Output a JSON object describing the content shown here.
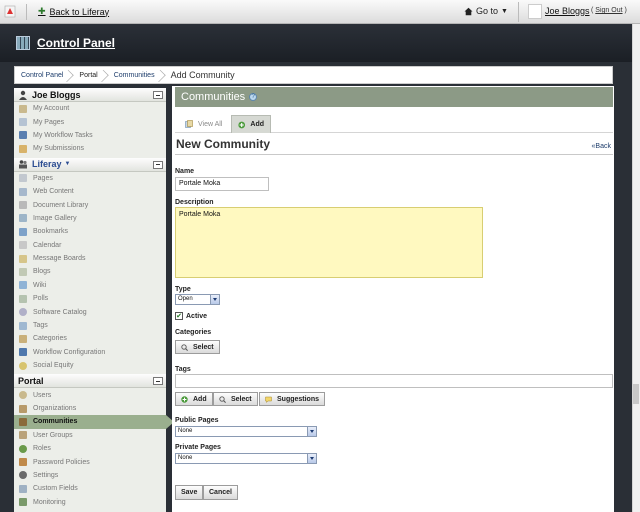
{
  "dockbar": {
    "back_link": "Back to Liferay",
    "goto_label": "Go to",
    "user_name": "Joe Bloggs",
    "sign_out_open": "(",
    "sign_out": "Sign Out",
    "sign_out_close": ")"
  },
  "header": {
    "title": "Control Panel"
  },
  "breadcrumb": [
    "Control Panel",
    "Portal",
    "Communities",
    "Add Community"
  ],
  "sidebar": {
    "user_section": {
      "title": "Joe Bloggs",
      "items": [
        "My Account",
        "My Pages",
        "My Workflow Tasks",
        "My Submissions"
      ]
    },
    "liferay_section": {
      "title": "Liferay",
      "items": [
        "Pages",
        "Web Content",
        "Document Library",
        "Image Gallery",
        "Bookmarks",
        "Calendar",
        "Message Boards",
        "Blogs",
        "Wiki",
        "Polls",
        "Software Catalog",
        "Tags",
        "Categories",
        "Workflow Configuration",
        "Social Equity"
      ]
    },
    "portal_section": {
      "title": "Portal",
      "items": [
        "Users",
        "Organizations",
        "Communities",
        "User Groups",
        "Roles",
        "Password Policies",
        "Settings",
        "Custom Fields",
        "Monitoring"
      ],
      "active": "Communities"
    }
  },
  "portlet": {
    "title": "Communities",
    "help": "?",
    "tabs": {
      "view_all": "View All",
      "add": "Add"
    },
    "form_title": "New Community",
    "back": "«Back"
  },
  "form": {
    "name_label": "Name",
    "name_value": "Portale Moka",
    "description_label": "Description",
    "description_value": "Portale Moka",
    "type_label": "Type",
    "type_value": "Open",
    "active_label": "Active",
    "active_checked": true,
    "categories_label": "Categories",
    "categories_select": "Select",
    "tags_label": "Tags",
    "tags_add": "Add",
    "tags_select": "Select",
    "tags_suggestions": "Suggestions",
    "public_pages_label": "Public Pages",
    "public_pages_value": "None",
    "private_pages_label": "Private Pages",
    "private_pages_value": "None",
    "save": "Save",
    "cancel": "Cancel"
  },
  "colors": {
    "portlet_title_bg": "#8c9a86",
    "active_item_bg": "#9aaf8e",
    "header_bg": "#1b1f25",
    "description_bg": "#fff9c0",
    "link": "#1c3c6b"
  }
}
